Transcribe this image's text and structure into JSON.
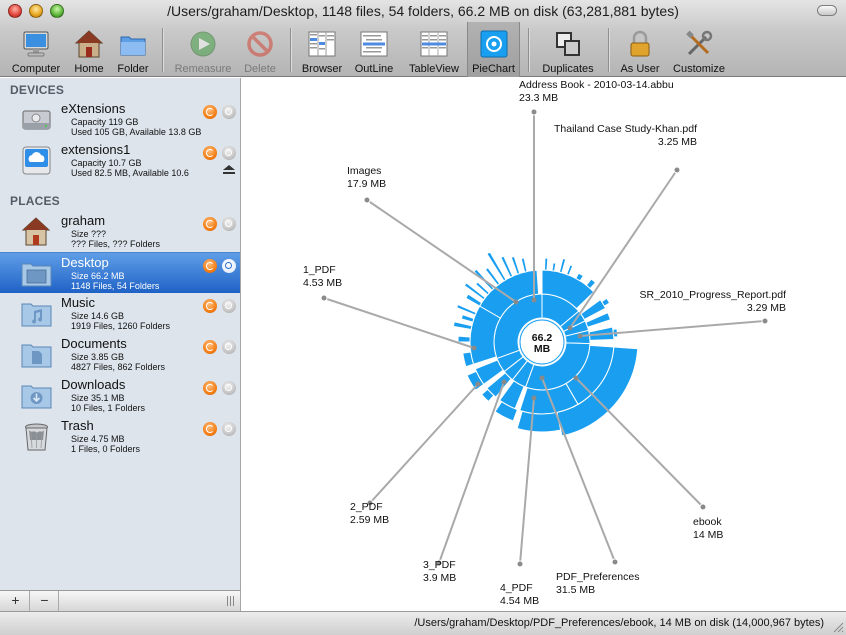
{
  "window": {
    "title": "/Users/graham/Desktop, 1148 files, 54 folders, 66.2 MB on disk (63,281,881 bytes)"
  },
  "toolbar": {
    "computer": "Computer",
    "home": "Home",
    "folder": "Folder",
    "remeasure": "Remeasure",
    "delete": "Delete",
    "browser": "Browser",
    "outline": "OutLine",
    "tableview": "TableView",
    "piechart": "PieChart",
    "duplicates": "Duplicates",
    "asuser": "As User",
    "customize": "Customize"
  },
  "sidebar": {
    "devices_header": "DEVICES",
    "places_header": "PLACES",
    "devices": [
      {
        "name": "eXtensions",
        "line1": "Capacity 119 GB",
        "line2": "Used 105 GB, Available 13.8 GB"
      },
      {
        "name": "extensions1",
        "line1": "Capacity 10.7 GB",
        "line2": "Used 82.5 MB, Available 10.6"
      }
    ],
    "places": [
      {
        "name": "graham",
        "line1": "Size ???",
        "line2": "??? Files, ??? Folders"
      },
      {
        "name": "Desktop",
        "line1": "Size 66.2 MB",
        "line2": "1148 Files, 54 Folders"
      },
      {
        "name": "Music",
        "line1": "Size 14.6 GB",
        "line2": "1919 Files, 1260 Folders"
      },
      {
        "name": "Documents",
        "line1": "Size 3.85 GB",
        "line2": "4827 Files, 862 Folders"
      },
      {
        "name": "Downloads",
        "line1": "Size 35.1 MB",
        "line2": "10 Files, 1 Folders"
      },
      {
        "name": "Trash",
        "line1": "Size 4.75 MB",
        "line2": "1 Files, 0 Folders"
      }
    ],
    "add_label": "+",
    "remove_label": "−"
  },
  "chart": {
    "center": [
      "66.2",
      "MB"
    ],
    "labels": [
      {
        "name": "Address Book - 2010-03-14.abbu",
        "size": "23.3 MB"
      },
      {
        "name": "Thailand Case Study-Khan.pdf",
        "size": "3.25 MB"
      },
      {
        "name": "Images",
        "size": "17.9 MB"
      },
      {
        "name": "1_PDF",
        "size": "4.53 MB"
      },
      {
        "name": "SR_2010_Progress_Report.pdf",
        "size": "3.29 MB"
      },
      {
        "name": "2_PDF",
        "size": "2.59 MB"
      },
      {
        "name": "ebook",
        "size": "14 MB"
      },
      {
        "name": "3_PDF",
        "size": "3.9 MB"
      },
      {
        "name": "PDF_Preferences",
        "size": "31.5 MB"
      },
      {
        "name": "4_PDF",
        "size": "4.54 MB"
      }
    ]
  },
  "status": {
    "text": "/Users/graham/Desktop/PDF_Preferences/ebook, 14 MB on disk (14,000,967 bytes)"
  },
  "colors": {
    "sunburst": "#1a9ff0",
    "selection": "#2a6fd0"
  }
}
